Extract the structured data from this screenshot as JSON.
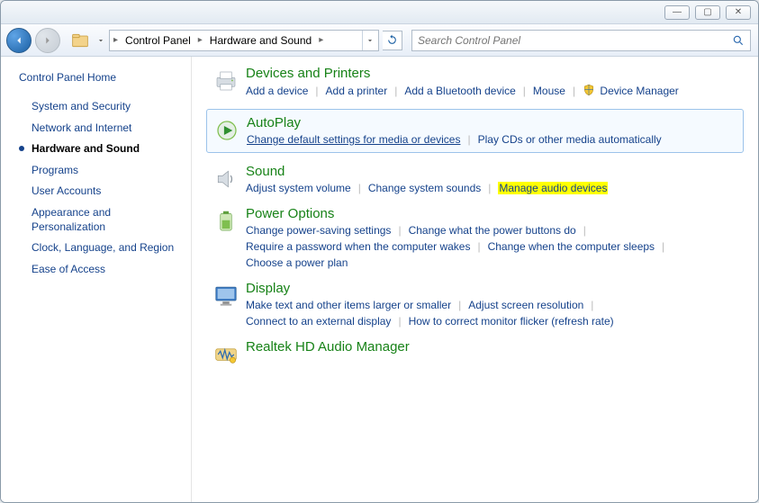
{
  "window": {
    "min": "—",
    "max": "▢",
    "close": "✕"
  },
  "nav": {
    "breadcrumb": {
      "root_arrow": "▸",
      "cp": "Control Panel",
      "hs": "Hardware and Sound"
    },
    "search_placeholder": "Search Control Panel"
  },
  "sidebar": {
    "home": "Control Panel Home",
    "items": [
      {
        "label": "System and Security",
        "active": false
      },
      {
        "label": "Network and Internet",
        "active": false
      },
      {
        "label": "Hardware and Sound",
        "active": true
      },
      {
        "label": "Programs",
        "active": false
      },
      {
        "label": "User Accounts",
        "active": false
      },
      {
        "label": "Appearance and Personalization",
        "active": false
      },
      {
        "label": "Clock, Language, and Region",
        "active": false
      },
      {
        "label": "Ease of Access",
        "active": false
      }
    ]
  },
  "sections": {
    "devices": {
      "title": "Devices and Printers",
      "l1": "Add a device",
      "l2": "Add a printer",
      "l3": "Add a Bluetooth device",
      "l4": "Mouse",
      "l5": "Device Manager"
    },
    "autoplay": {
      "title": "AutoPlay",
      "l1": "Change default settings for media or devices",
      "l2": "Play CDs or other media automatically"
    },
    "sound": {
      "title": "Sound",
      "l1": "Adjust system volume",
      "l2": "Change system sounds",
      "l3": "Manage audio devices"
    },
    "power": {
      "title": "Power Options",
      "l1": "Change power-saving settings",
      "l2": "Change what the power buttons do",
      "l3": "Require a password when the computer wakes",
      "l4": "Change when the computer sleeps",
      "l5": "Choose a power plan"
    },
    "display": {
      "title": "Display",
      "l1": "Make text and other items larger or smaller",
      "l2": "Adjust screen resolution",
      "l3": "Connect to an external display",
      "l4": "How to correct monitor flicker (refresh rate)"
    },
    "realtek": {
      "title": "Realtek HD Audio Manager"
    }
  }
}
